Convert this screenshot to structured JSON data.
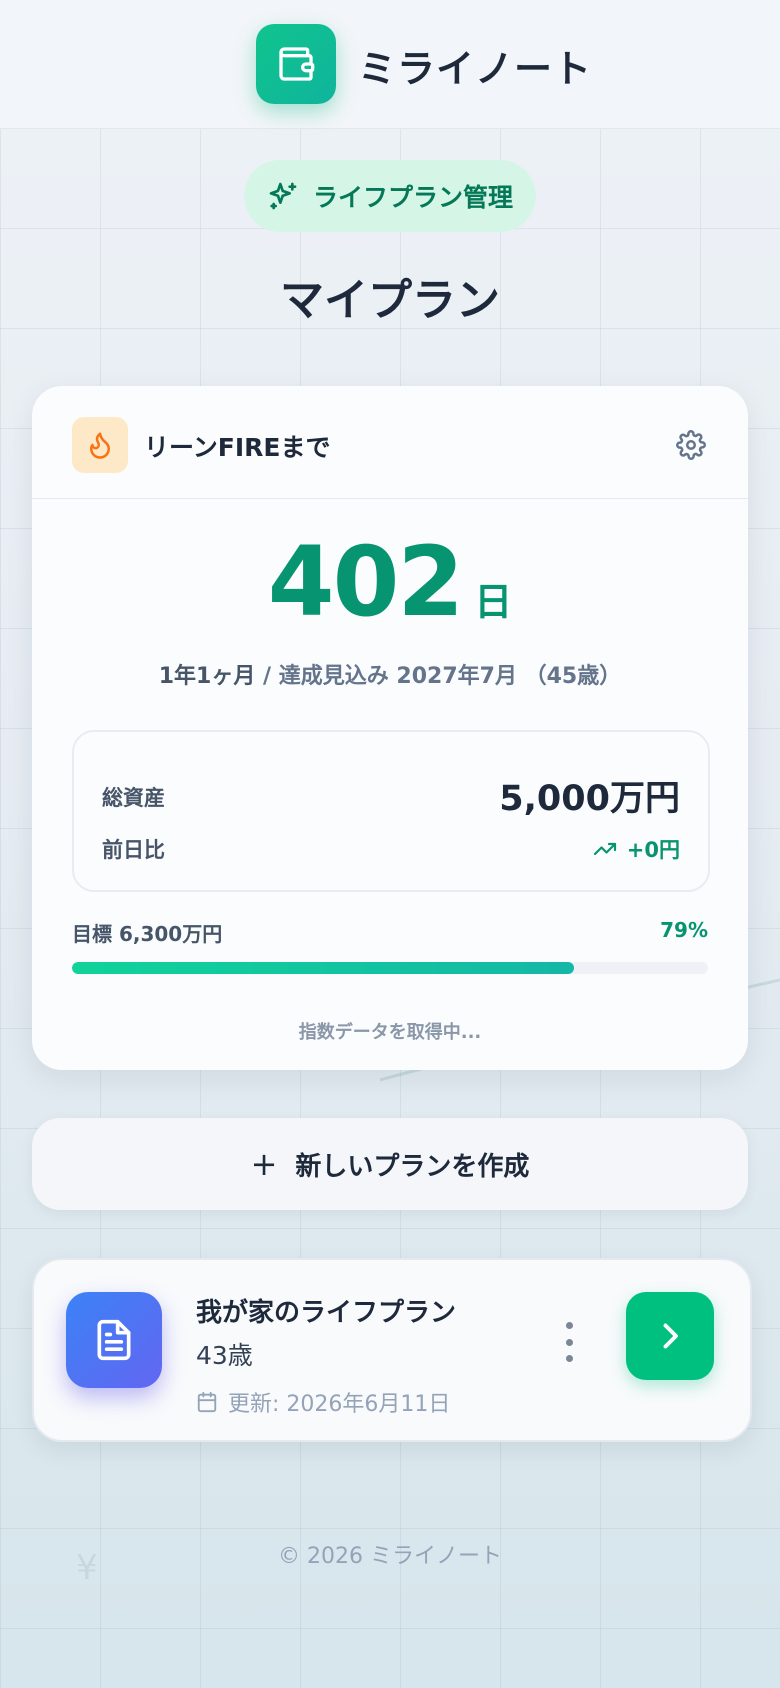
{
  "header": {
    "app_name": "ミライノート",
    "logo_icon": "wallet-icon"
  },
  "badge": {
    "label": "ライフプラン管理",
    "icon": "sparkles-icon"
  },
  "page": {
    "title": "マイプラン"
  },
  "fire_card": {
    "heading": "リーンFIREまで",
    "heading_icon": "flame-icon",
    "settings_icon": "gear-icon",
    "days": "402",
    "days_unit": "日",
    "duration": "1年1ヶ月",
    "separator": "/",
    "forecast": "達成見込み 2027年7月 （45歳）",
    "total_assets_label": "総資産",
    "total_assets_value": "5,000万円",
    "day_change_label": "前日比",
    "day_change_value": "+0円",
    "goal_label": "目標 6,300万円",
    "progress_pct_label": "79%",
    "progress_fraction": 0.79,
    "loading_text": "指数データを取得中..."
  },
  "actions": {
    "new_plan_label": "新しいプランを作成",
    "new_plan_icon": "+"
  },
  "plan": {
    "name": "我が家のライフプラン",
    "age": "43歳",
    "updated": "更新: 2026年6月11日",
    "icon": "document-icon"
  },
  "footer": {
    "copyright": "© 2026 ミライノート"
  },
  "decor": {
    "yen": "¥"
  },
  "colors": {
    "primary": "#079470",
    "accent_green": "#00c07f",
    "badge_bg": "#d5f5e6",
    "flame": "#f97316",
    "doc_gradient": [
      "#3b82f6",
      "#6366f1"
    ]
  }
}
